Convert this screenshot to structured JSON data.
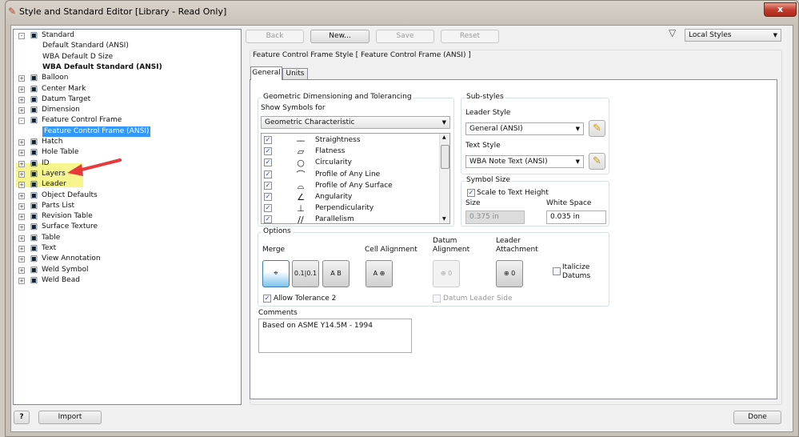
{
  "window": {
    "title": "Style and Standard Editor [Library - Read Only]",
    "close_label": "x"
  },
  "tree": {
    "items": [
      {
        "label": "Standard",
        "icon": "standard-icon",
        "expander": "-",
        "level": 0
      },
      {
        "label": "Default Standard (ANSI)",
        "level": 1
      },
      {
        "label": "WBA Default D Size",
        "level": 1
      },
      {
        "label": "WBA Default Standard (ANSI)",
        "level": 1,
        "bold": true
      },
      {
        "label": "Balloon",
        "icon": "balloon-icon",
        "expander": "+",
        "level": 0
      },
      {
        "label": "Center Mark",
        "icon": "center-mark-icon",
        "expander": "+",
        "level": 0
      },
      {
        "label": "Datum Target",
        "icon": "datum-target-icon",
        "expander": "+",
        "level": 0
      },
      {
        "label": "Dimension",
        "icon": "dimension-icon",
        "expander": "+",
        "level": 0
      },
      {
        "label": "Feature Control Frame",
        "icon": "feature-control-frame-icon",
        "expander": "-",
        "level": 0
      },
      {
        "label": "Feature Control Frame (ANSI)",
        "level": 1,
        "selected": true
      },
      {
        "label": "Hatch",
        "icon": "hatch-icon",
        "expander": "+",
        "level": 0
      },
      {
        "label": "Hole Table",
        "icon": "hole-table-icon",
        "expander": "+",
        "level": 0
      },
      {
        "label": "ID",
        "icon": "id-icon",
        "expander": "+",
        "level": 0
      },
      {
        "label": "Layers",
        "icon": "layers-icon",
        "expander": "+",
        "level": 0,
        "highlight": true
      },
      {
        "label": "Leader",
        "icon": "leader-icon",
        "expander": "+",
        "level": 0,
        "highlight": true
      },
      {
        "label": "Object Defaults",
        "icon": "object-defaults-icon",
        "expander": "+",
        "level": 0
      },
      {
        "label": "Parts List",
        "icon": "parts-list-icon",
        "expander": "+",
        "level": 0
      },
      {
        "label": "Revision Table",
        "icon": "revision-table-icon",
        "expander": "+",
        "level": 0
      },
      {
        "label": "Surface Texture",
        "icon": "surface-texture-icon",
        "expander": "+",
        "level": 0
      },
      {
        "label": "Table",
        "icon": "table-icon",
        "expander": "+",
        "level": 0
      },
      {
        "label": "Text",
        "icon": "text-icon",
        "expander": "+",
        "level": 0
      },
      {
        "label": "View Annotation",
        "icon": "view-annotation-icon",
        "expander": "+",
        "level": 0
      },
      {
        "label": "Weld Symbol",
        "icon": "weld-symbol-icon",
        "expander": "+",
        "level": 0
      },
      {
        "label": "Weld Bead",
        "icon": "weld-bead-icon",
        "expander": "+",
        "level": 0
      }
    ]
  },
  "toolbar": {
    "back": "Back",
    "new": "New...",
    "save": "Save",
    "reset": "Reset",
    "filter_value": "Local Styles"
  },
  "style_title": "Feature Control Frame Style [ Feature Control Frame (ANSI) ]",
  "tabs": [
    {
      "label": "General",
      "active": true
    },
    {
      "label": "Units"
    }
  ],
  "gdt": {
    "group": "Geometric Dimensioning and Tolerancing",
    "show_label": "Show Symbols for",
    "show_value": "Geometric Characteristic",
    "symbols": [
      {
        "glyph": "—",
        "label": "Straightness",
        "checked": true
      },
      {
        "glyph": "▱",
        "label": "Flatness",
        "checked": true
      },
      {
        "glyph": "○",
        "label": "Circularity",
        "checked": true
      },
      {
        "glyph": "⌒",
        "label": "Profile of Any Line",
        "checked": true
      },
      {
        "glyph": "⌓",
        "label": "Profile of Any Surface",
        "checked": true
      },
      {
        "glyph": "∠",
        "label": "Angularity",
        "checked": true
      },
      {
        "glyph": "⊥",
        "label": "Perpendicularity",
        "checked": true
      },
      {
        "glyph": "∕∕",
        "label": "Parallelism",
        "checked": true
      }
    ]
  },
  "substyles": {
    "group": "Sub-styles",
    "leader_label": "Leader Style",
    "leader_value": "General (ANSI)",
    "text_label": "Text Style",
    "text_value": "WBA Note Text (ANSI)"
  },
  "symbol_size": {
    "group": "Symbol Size",
    "scale_label": "Scale to Text Height",
    "scale_checked": true,
    "size_label": "Size",
    "size_value": "0.375 in",
    "ws_label": "White Space",
    "ws_value": "0.035 in"
  },
  "options": {
    "group": "Options",
    "merge": "Merge",
    "cell_alignment": "Cell Alignment",
    "datum_alignment": "Datum Alignment",
    "leader_attachment": "Leader Attachment",
    "italicize": "Italicize Datums",
    "allow_tol": "Allow Tolerance 2",
    "allow_tol_checked": true,
    "datum_leader_side": "Datum Leader Side",
    "merge_b1": "⌖",
    "merge_b2": "0.1|0.1",
    "merge_b3": "A B",
    "cell_b": "A ⊕",
    "datum_b": "⊕ 0",
    "leader_b": "⊕ 0"
  },
  "comments": {
    "label": "Comments",
    "value": "Based on ASME Y14.5M - 1994"
  },
  "footer": {
    "help": "?",
    "import": "Import",
    "done": "Done"
  },
  "colors": {
    "selection": "#3399ff",
    "highlight": "#f6f37a",
    "arrow": "#e8393b"
  }
}
